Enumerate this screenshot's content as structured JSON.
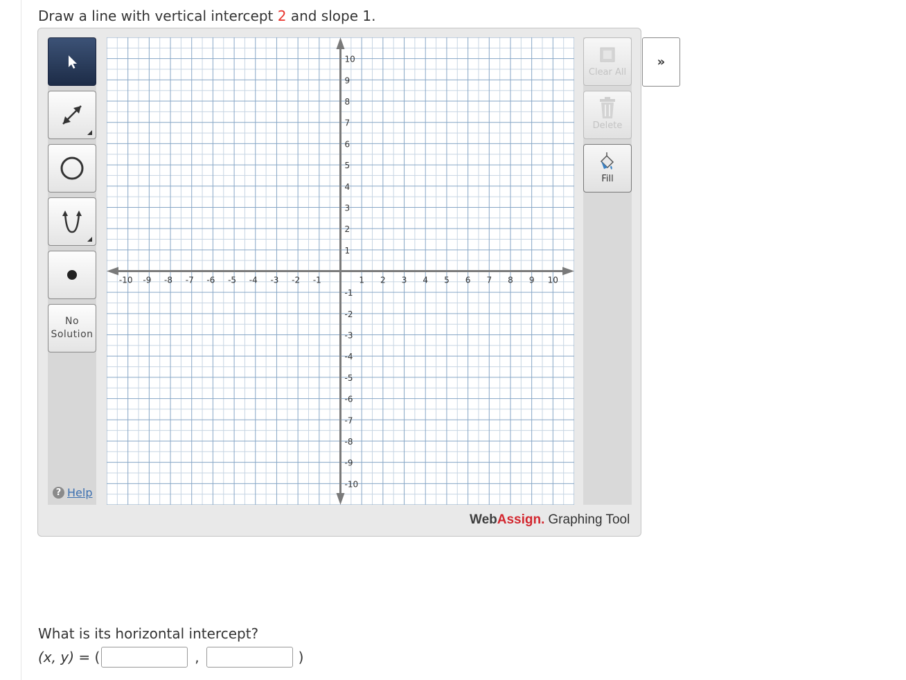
{
  "prompt": {
    "part1": "Draw a line with vertical intercept ",
    "intercept": "2",
    "part2": " and slope 1."
  },
  "tools": {
    "items": [
      {
        "name": "select-tool",
        "icon": "pointer-arrow-icon",
        "active": true
      },
      {
        "name": "line-tool",
        "icon": "double-arrow-line-icon",
        "has_submenu": true
      },
      {
        "name": "circle-tool",
        "icon": "circle-icon"
      },
      {
        "name": "parabola-tool",
        "icon": "parabola-icon",
        "has_submenu": true
      },
      {
        "name": "point-tool",
        "icon": "dot-icon"
      },
      {
        "name": "no-solution-tool",
        "label_line1": "No",
        "label_line2": "Solution"
      }
    ],
    "help_label": "Help"
  },
  "actions": {
    "clear_all": "Clear All",
    "delete": "Delete",
    "fill": "Fill",
    "expand": "»"
  },
  "graph": {
    "xmin": -11,
    "xmax": 11,
    "ymin": -11,
    "ymax": 11,
    "minor_step": 0.5,
    "major_step": 1,
    "x_tick_labels": [
      "-10",
      "-9",
      "-8",
      "-7",
      "-6",
      "-5",
      "-4",
      "-3",
      "-2",
      "-1",
      "1",
      "2",
      "3",
      "4",
      "5",
      "6",
      "7",
      "8",
      "9",
      "10"
    ],
    "y_tick_labels": [
      "10",
      "9",
      "8",
      "7",
      "6",
      "5",
      "4",
      "3",
      "2",
      "1",
      "-1",
      "-2",
      "-3",
      "-4",
      "-5",
      "-6",
      "-7",
      "-8",
      "-9",
      "-10"
    ],
    "axis_color": "#7a7a7a",
    "major_grid_color": "#86a6c6",
    "minor_grid_color": "#c7d5e3"
  },
  "brand": {
    "web": "Web",
    "assign": "Assign.",
    "tool": "Graphing Tool"
  },
  "question2": {
    "text": "What is its horizontal intercept?",
    "lhs": "(x, y)",
    "eq": " = (",
    "comma": ",",
    "close": ")",
    "x_value": "",
    "y_value": ""
  }
}
